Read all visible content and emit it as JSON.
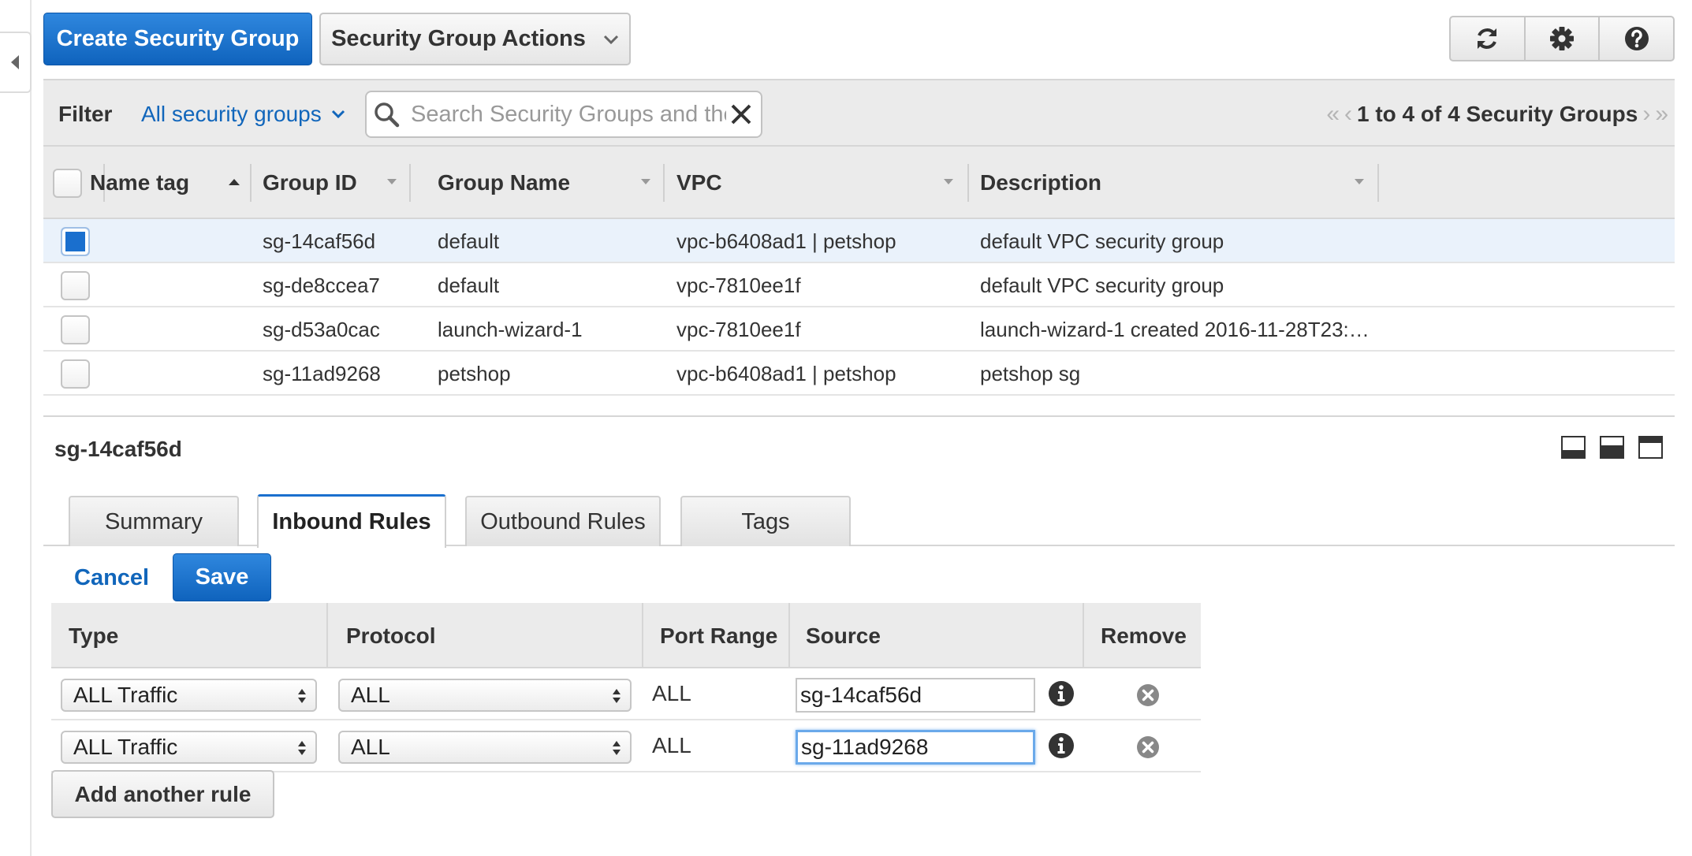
{
  "toolbar": {
    "create_label": "Create Security Group",
    "actions_label": "Security Group Actions"
  },
  "filter": {
    "label": "Filter",
    "selected": "All security groups",
    "search_placeholder": "Search Security Groups and their properties",
    "pager_text": "1 to 4 of 4 Security Groups"
  },
  "groups_table": {
    "headers": [
      "Name tag",
      "Group ID",
      "Group Name",
      "VPC",
      "Description"
    ],
    "rows": [
      {
        "name_tag": "",
        "group_id": "sg-14caf56d",
        "group_name": "default",
        "vpc": "vpc-b6408ad1 | petshop",
        "description": "default VPC security group",
        "checked": true
      },
      {
        "name_tag": "",
        "group_id": "sg-de8ccea7",
        "group_name": "default",
        "vpc": "vpc-7810ee1f",
        "description": "default VPC security group",
        "checked": false
      },
      {
        "name_tag": "",
        "group_id": "sg-d53a0cac",
        "group_name": "launch-wizard-1",
        "vpc": "vpc-7810ee1f",
        "description": "launch-wizard-1 created 2016-11-28T23:…",
        "checked": false
      },
      {
        "name_tag": "",
        "group_id": "sg-11ad9268",
        "group_name": "petshop",
        "vpc": "vpc-b6408ad1 | petshop",
        "description": "petshop sg",
        "checked": false
      }
    ]
  },
  "detail": {
    "title": "sg-14caf56d",
    "tabs": [
      "Summary",
      "Inbound Rules",
      "Outbound Rules",
      "Tags"
    ],
    "active_tab": "Inbound Rules",
    "cancel_label": "Cancel",
    "save_label": "Save",
    "rules_headers": [
      "Type",
      "Protocol",
      "Port Range",
      "Source",
      "Remove"
    ],
    "rules": [
      {
        "type": "ALL Traffic",
        "protocol": "ALL",
        "port_range": "ALL",
        "source": "sg-14caf56d"
      },
      {
        "type": "ALL Traffic",
        "protocol": "ALL",
        "port_range": "ALL",
        "source": "sg-11ad9268"
      }
    ],
    "add_rule_label": "Add another rule"
  },
  "colors": {
    "primary": "#1a6fce",
    "link": "#1166bb",
    "header_bg": "#ebebeb",
    "selected_row": "#eaf2fb"
  },
  "icons": [
    "collapse-left-icon",
    "refresh-icon",
    "gear-icon",
    "help-icon",
    "search-icon",
    "clear-icon",
    "chevron-down-icon",
    "sort-asc-icon",
    "info-icon",
    "remove-icon"
  ]
}
